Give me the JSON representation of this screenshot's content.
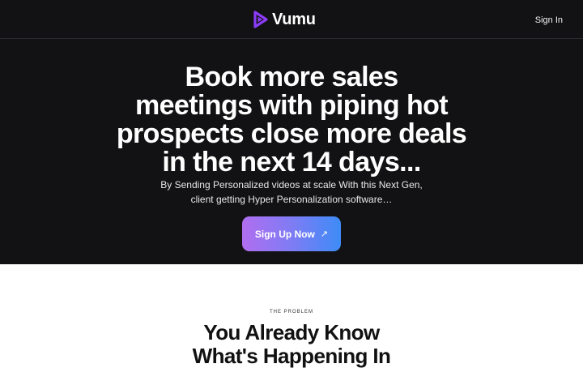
{
  "nav": {
    "brand": "Vumu",
    "signin_label": "Sign In"
  },
  "hero": {
    "headline_lines": [
      "Book more sales",
      "meetings with piping hot",
      "prospects close more deals",
      "in the next 14 days..."
    ],
    "subtitle_lines": [
      "By Sending Personalized videos at scale With this Next Gen,",
      "client getting Hyper Personalization software…"
    ],
    "cta_label": "Sign Up Now",
    "cta_icon": "arrow-up-right-icon"
  },
  "problem": {
    "kicker": "THE PROBLEM",
    "title_lines": [
      "You Already Know",
      "What's Happening In"
    ]
  },
  "colors": {
    "hero_bg": "#121214",
    "logo_purple": "#8b3cf7",
    "cta_gradient_start": "#b06ef0",
    "cta_gradient_end": "#3d8cf7"
  }
}
